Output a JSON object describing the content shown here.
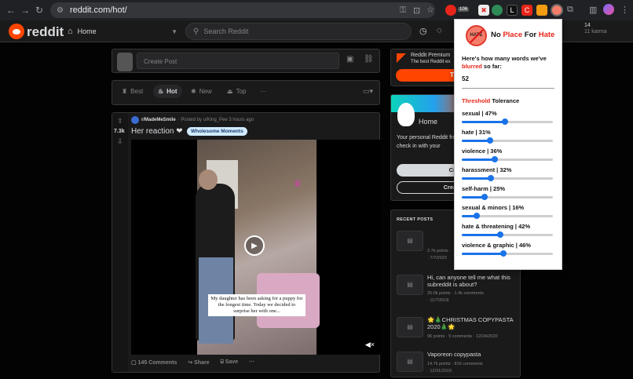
{
  "browser": {
    "back": "←",
    "forward": "→",
    "reload": "↻",
    "url": "reddit.com/hot/",
    "badge": "106",
    "ext_letters": [
      "C",
      "L"
    ]
  },
  "header": {
    "logo_text": "reddit",
    "home_label": "Home",
    "search_placeholder": "Search Reddit",
    "karma_count": "14",
    "karma_label": "11 karma"
  },
  "create_post": {
    "placeholder": "Create Post"
  },
  "sort": {
    "best": "Best",
    "hot": "Hot",
    "new": "New",
    "top": "Top",
    "more": "···"
  },
  "post": {
    "score": "7.3k",
    "subreddit": "r/MadeMeSmile",
    "posted_by": "· Posted by u/King_Pee 3 hours ago",
    "title": "Her reaction ❤",
    "flair": "Wholesome Moments",
    "caption": "My daughter has been asking for a puppy for the longest time. Today we decided to surprise her with one...",
    "comments": "145 Comments",
    "share": "Share",
    "save": "Save",
    "more": "···"
  },
  "premium": {
    "title": "Reddit Premium",
    "subtitle": "The best Reddit ex",
    "button": "Try"
  },
  "home_card": {
    "title": "Home",
    "text": "Your personal Reddit frontpage. Come here to check in with your",
    "create_post": "Crea",
    "create_community": "Create C"
  },
  "recent": {
    "heading": "RECENT POSTS",
    "items": [
      {
        "title": "",
        "stats": "2.7k points · ",
        "date": "· 7/7/2023"
      },
      {
        "title": "Hi, can anyone tell me what this subreddit is about?",
        "stats": "25.0k points · 1.4k comments",
        "date": "· 11/7/2018"
      },
      {
        "title": "🌟🎄CHRISTMAS COPYPASTA 2020🎄🌟",
        "stats": "96 points · 5 comments · 12/24/2020",
        "date": ""
      },
      {
        "title": "Vaporeon copypasta",
        "stats": "14.7k points · 816 comments",
        "date": "· 12/31/2019"
      }
    ]
  },
  "popup": {
    "logo_text": "HATE",
    "title_prefix": "No ",
    "title_red1": "Place",
    "title_mid": " For ",
    "title_red2": "Hate",
    "count_text_1": "Here's how many words we've ",
    "count_text_red": "blurred",
    "count_text_2": " so far:",
    "count": "52",
    "tolerance_red": "Threshold",
    "tolerance_rest": " Tolerance",
    "sliders": [
      {
        "label": "sexual | 47%",
        "value": 47
      },
      {
        "label": "hate | 31%",
        "value": 31
      },
      {
        "label": "violence | 36%",
        "value": 36
      },
      {
        "label": "harassment | 32%",
        "value": 32
      },
      {
        "label": "self-harm | 25%",
        "value": 25
      },
      {
        "label": "sexual & minors | 16%",
        "value": 16
      },
      {
        "label": "hate & threatening | 42%",
        "value": 42
      },
      {
        "label": "violence & graphic | 46%",
        "value": 46
      }
    ]
  },
  "colors": {
    "accent": "#e8251a",
    "reddit_orange": "#ff4500",
    "slider": "#1a73e8"
  }
}
